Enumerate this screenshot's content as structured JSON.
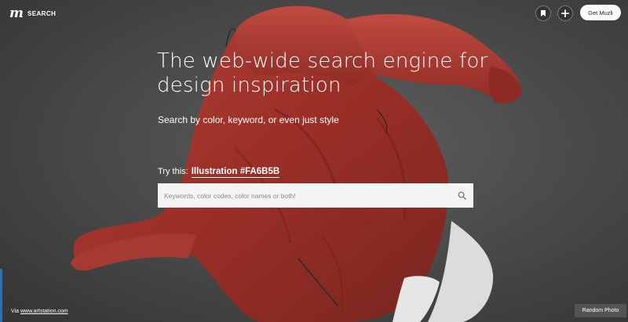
{
  "header": {
    "logo": "m",
    "logo_label": "SEARCH",
    "get_button_label": "Get Muzli"
  },
  "hero": {
    "headline_line1": "The web-wide search engine for",
    "headline_line2": "design inspiration",
    "subhead": "Search by color, keyword, or even just style",
    "try_label": "Try this:",
    "try_example": "Illustration #FA6B5B"
  },
  "search": {
    "placeholder": "Keywords, color codes, color names or both!",
    "value": ""
  },
  "footer": {
    "credit_prefix": "Via",
    "credit_link": "www.artstation.com",
    "random_button_label": "Random Photo"
  },
  "colors": {
    "jacket": "#a8342a",
    "accent_example": "#FA6B5B"
  }
}
